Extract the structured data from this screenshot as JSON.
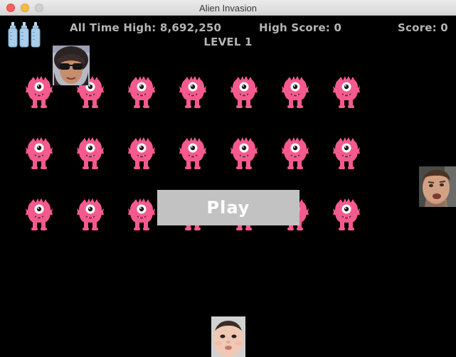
{
  "window": {
    "title": "Alien Invasion"
  },
  "hud": {
    "all_time_high": "All Time High: 8,692,250",
    "high_score": "High Score: 0",
    "score": "Score: 0",
    "level": "LEVEL 1"
  },
  "lives": {
    "count": 3,
    "icon": "baby-bottle-icon"
  },
  "fleet": {
    "rows": 3,
    "columns": 7,
    "alien_color": "#f55a8e",
    "icon": "pink-monster-icon"
  },
  "faces": {
    "top": "woman-with-sunglasses-portrait",
    "right": "man-face-portrait",
    "bottom": "baby-face-ship"
  },
  "play_button": {
    "label": "Play"
  },
  "colors": {
    "background": "#000000",
    "hud_text": "#b4b4b4",
    "button_bg": "#c2c2c2"
  }
}
